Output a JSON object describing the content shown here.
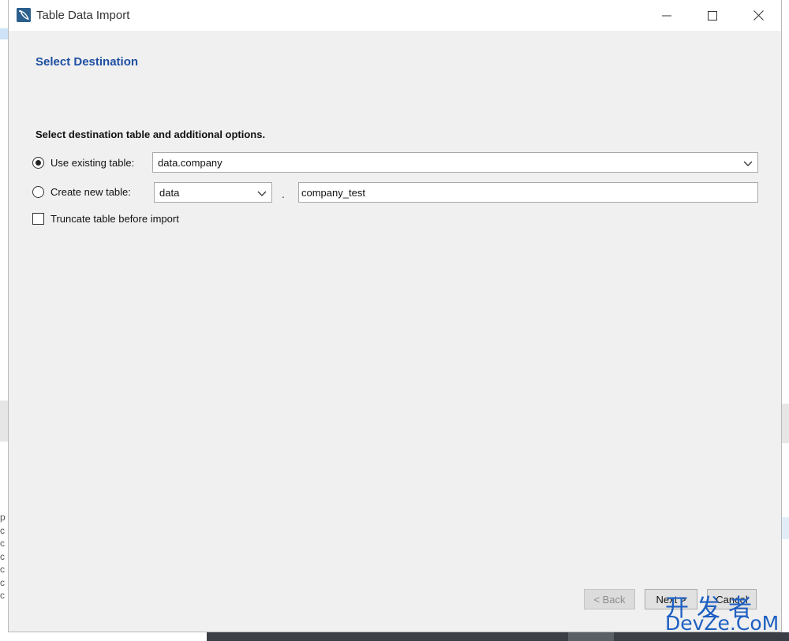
{
  "window": {
    "title": "Table Data Import",
    "controls": {
      "minimize": "minimize",
      "maximize": "maximize",
      "close": "close"
    }
  },
  "page": {
    "heading": "Select Destination",
    "section_label": "Select destination table and additional options."
  },
  "options": {
    "existing": {
      "label": "Use existing table:",
      "selected": true,
      "value": "data.company"
    },
    "new": {
      "label": "Create new table:",
      "selected": false,
      "schema": "data",
      "separator": ".",
      "table_name": "company_test"
    },
    "truncate": {
      "label": "Truncate table before import",
      "checked": false
    }
  },
  "buttons": {
    "back": "< Back",
    "next": "Next >",
    "cancel": "Cancel"
  },
  "watermark": {
    "cn": "开发者",
    "en": "DevZe.CoM"
  },
  "background": {
    "left_letters": "p\nc\nc\nc\nc\nc\nc"
  }
}
